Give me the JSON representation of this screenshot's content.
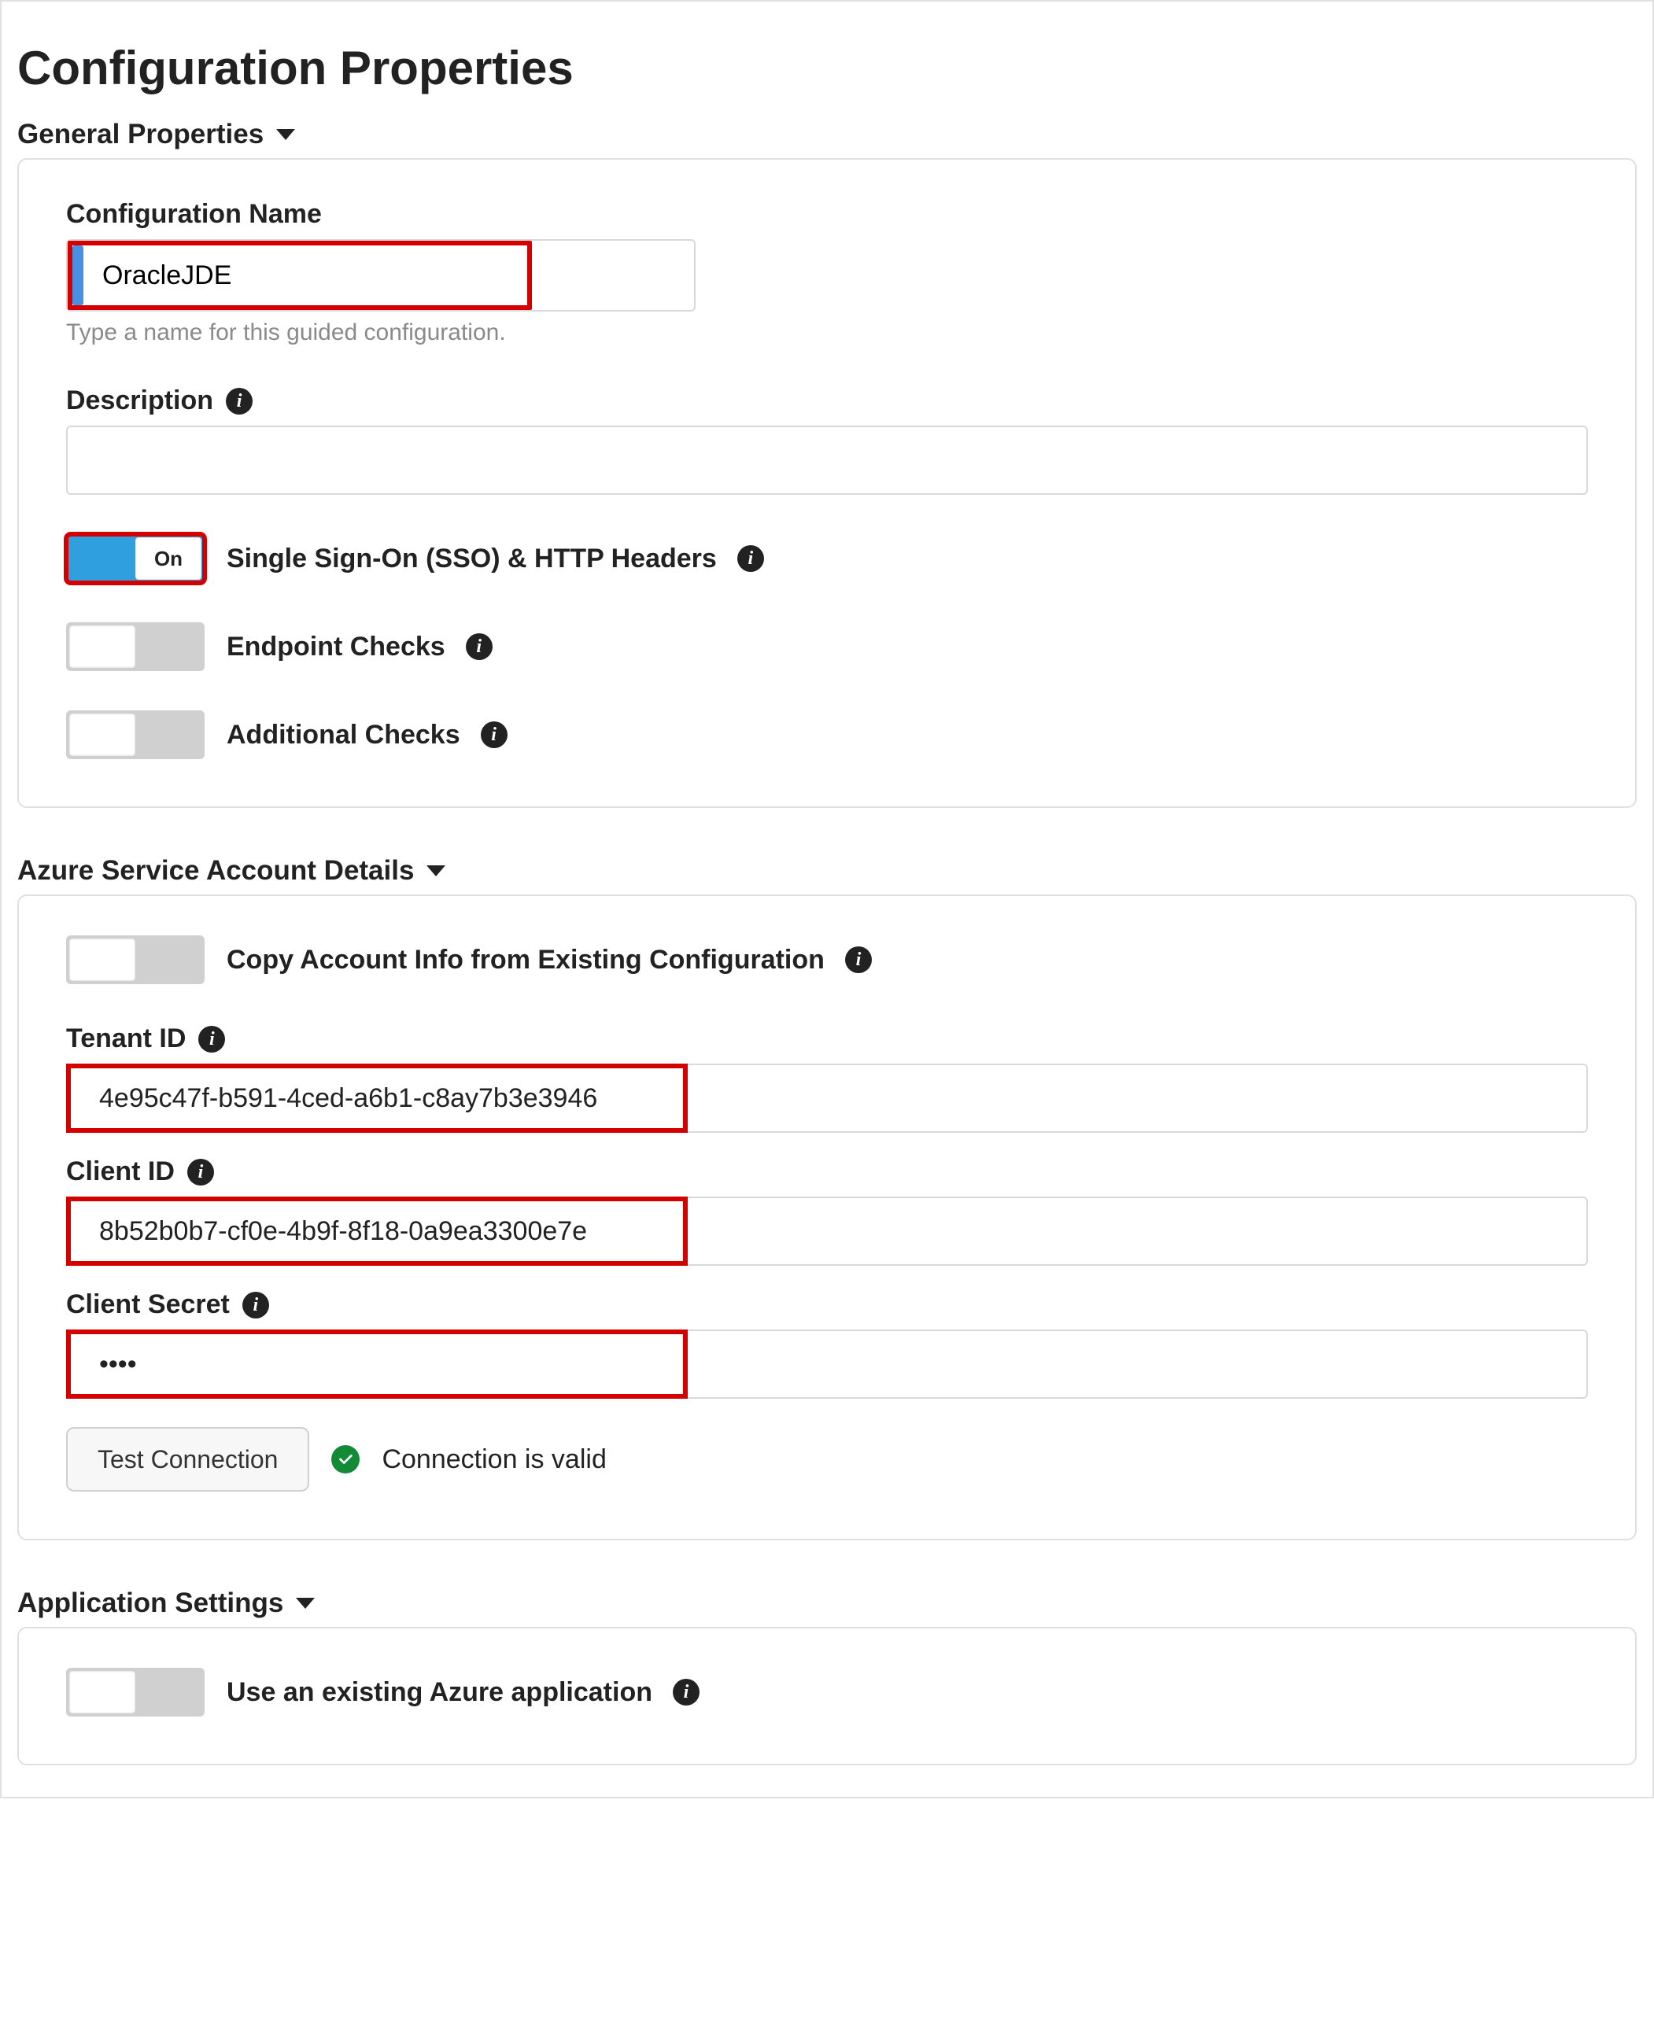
{
  "page": {
    "title": "Configuration Properties"
  },
  "sections": {
    "general": {
      "header": "General Properties",
      "configName": {
        "label": "Configuration Name",
        "value": "OracleJDE",
        "hint": "Type a name for this guided configuration."
      },
      "description": {
        "label": "Description",
        "value": ""
      },
      "toggles": {
        "sso": {
          "label": "Single Sign-On (SSO) & HTTP Headers",
          "on": true,
          "onText": "On"
        },
        "endpoint": {
          "label": "Endpoint Checks",
          "on": false
        },
        "additional": {
          "label": "Additional Checks",
          "on": false
        }
      }
    },
    "azure": {
      "header": "Azure Service Account Details",
      "copyExisting": {
        "label": "Copy Account Info from Existing Configuration",
        "on": false
      },
      "tenantId": {
        "label": "Tenant ID",
        "value": "4e95c47f-b591-4ced-a6b1-c8ay7b3e3946"
      },
      "clientId": {
        "label": "Client ID",
        "value": "8b52b0b7-cf0e-4b9f-8f18-0a9ea3300e7e"
      },
      "clientSecret": {
        "label": "Client Secret",
        "value": "••••"
      },
      "testConnection": {
        "buttonLabel": "Test Connection",
        "statusText": "Connection is valid"
      }
    },
    "appSettings": {
      "header": "Application Settings",
      "useExisting": {
        "label": "Use an existing Azure application",
        "on": false
      }
    }
  }
}
